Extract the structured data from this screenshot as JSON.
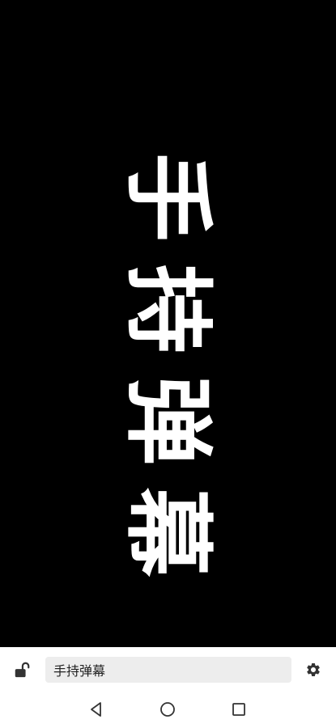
{
  "danmaku": {
    "text": "手持弹幕",
    "text_color": "#ffffff",
    "background_color": "#000000"
  },
  "input_bar": {
    "lock_icon": "lock-open-icon",
    "text_value": "手持弹幕",
    "settings_icon": "gear-icon"
  },
  "nav_bar": {
    "back_icon": "triangle-back-icon",
    "home_icon": "circle-home-icon",
    "recents_icon": "square-recents-icon"
  }
}
